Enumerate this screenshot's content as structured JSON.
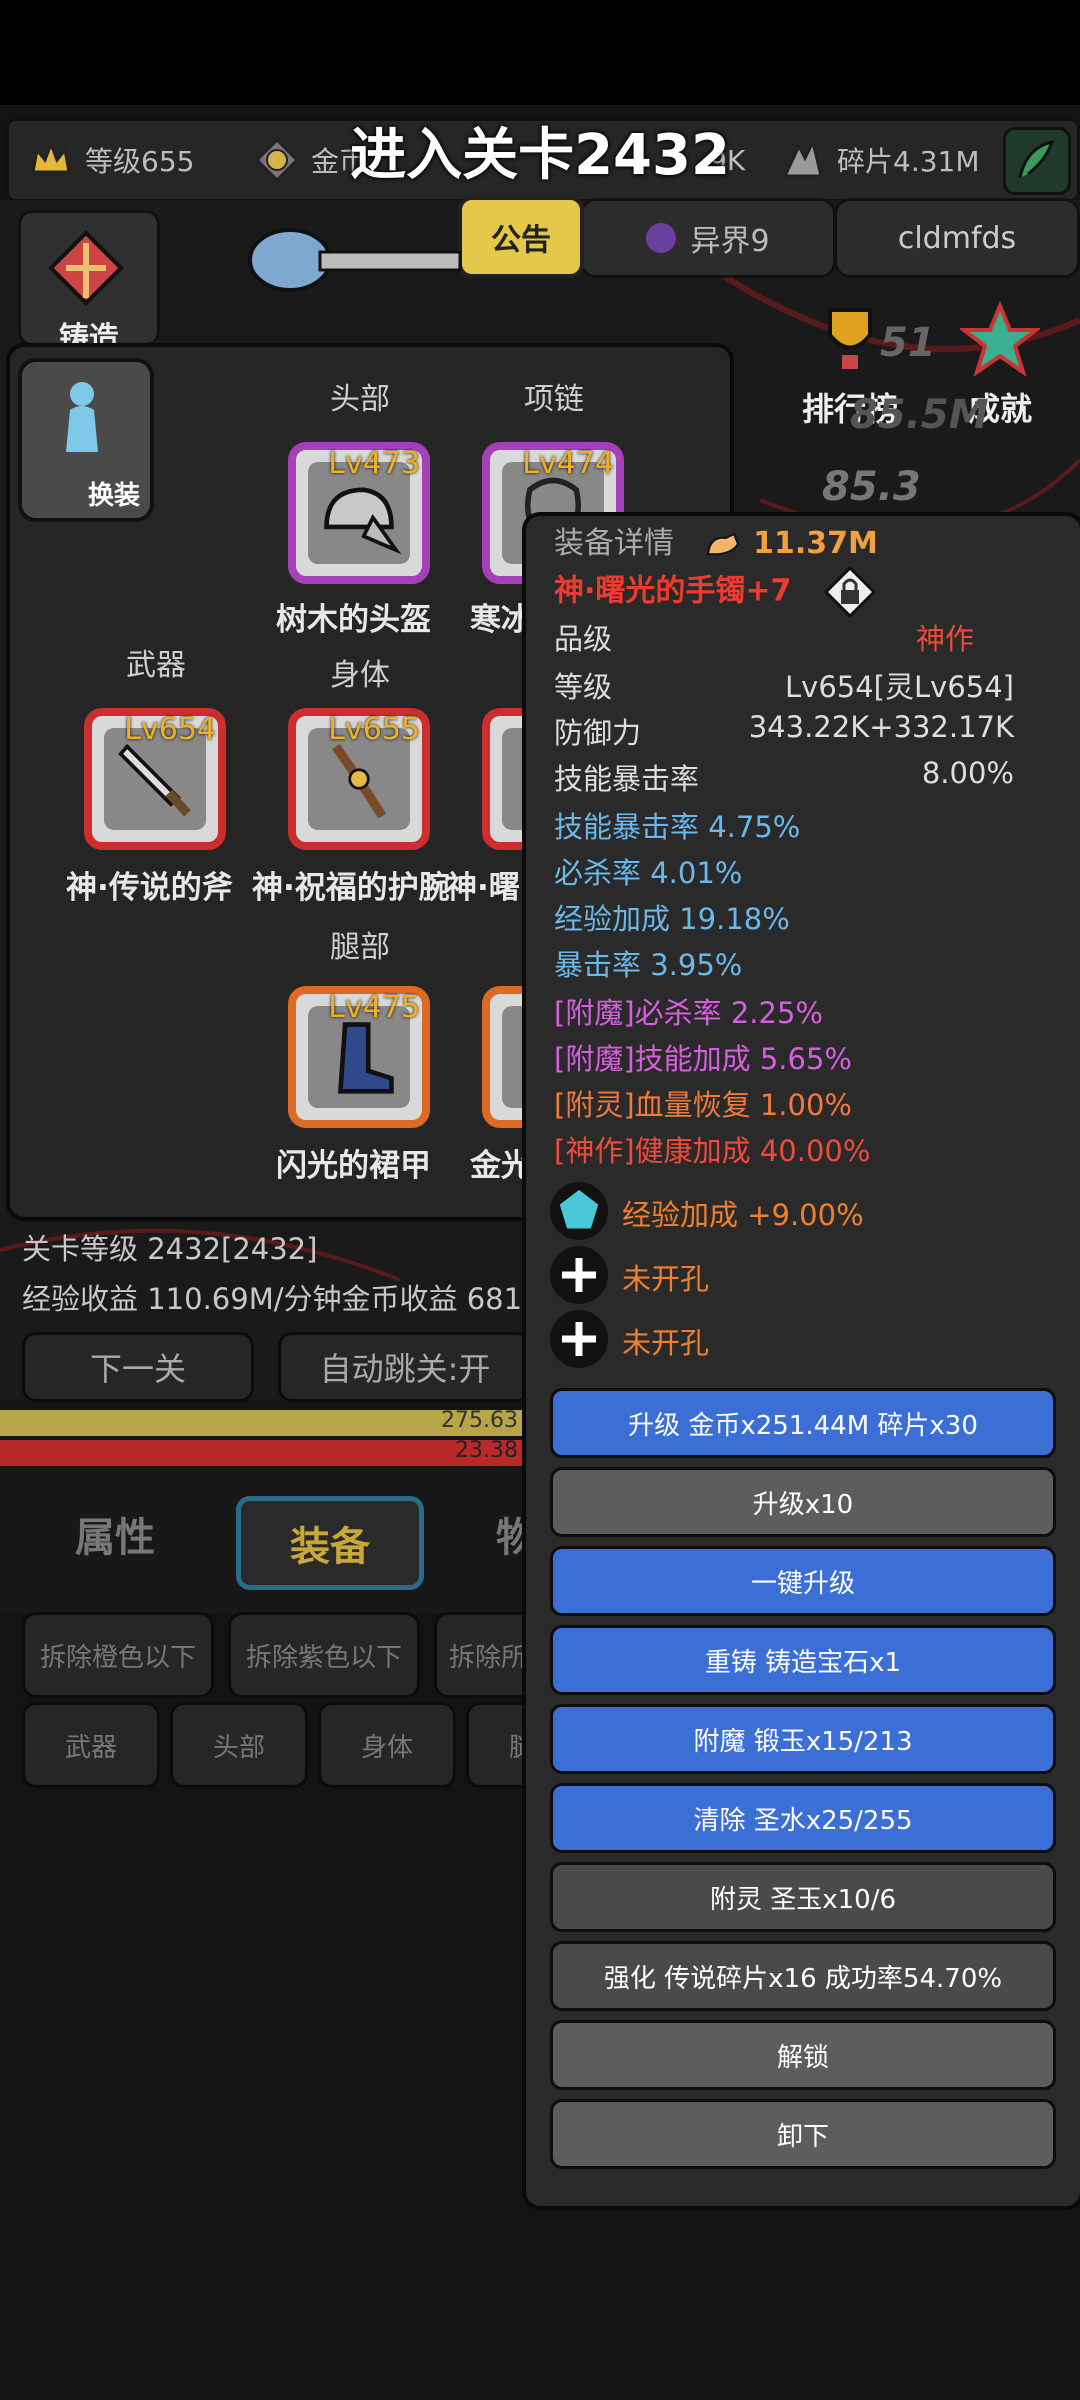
{
  "toast": "进入关卡2432",
  "resources": [
    {
      "icon": "crown-icon",
      "label": "等级655"
    },
    {
      "icon": "gold-coin-icon",
      "label": "金币"
    },
    {
      "icon": "",
      "label": "9K"
    },
    {
      "icon": "shard-icon",
      "label": "碎片4.31M"
    }
  ],
  "top_tabs": {
    "notice": "公告",
    "otherworld": "异界9",
    "username": "cldmfds"
  },
  "side_menu": {
    "cast": "铸造",
    "ranking": "排行榜",
    "achievement": "成就"
  },
  "bg_numbers": [
    "51",
    "85.5M",
    "85.3"
  ],
  "equip_panel": {
    "change_label": "换装",
    "slots": [
      {
        "slot_label": "头部",
        "level": "Lv473",
        "name": "树木的头盔",
        "rarity": "purple"
      },
      {
        "slot_label": "项链",
        "level": "Lv474",
        "name": "寒冰",
        "rarity": "purple"
      },
      {
        "slot_label": "武器",
        "level": "Lv654",
        "name": "神·传说的斧",
        "rarity": "red"
      },
      {
        "slot_label": "身体",
        "level": "Lv655",
        "name": "神·祝福的护腕",
        "rarity": "red"
      },
      {
        "slot_label": "",
        "level": "",
        "name": "神·曙",
        "rarity": "red"
      },
      {
        "slot_label": "腿部",
        "level": "Lv475",
        "name": "闪光的裙甲",
        "rarity": "orange"
      },
      {
        "slot_label": "",
        "level": "",
        "name": "金光",
        "rarity": "orange"
      }
    ]
  },
  "stage_info": {
    "stage_level": "关卡等级 2432[2432]",
    "income": "经验收益 110.69M/分钟金币收益 681."
  },
  "stage_buttons": {
    "next": "下一关",
    "auto": "自动跳关:开"
  },
  "bars": {
    "gold_value": "275.63",
    "red_value": "23.38"
  },
  "bottom_tabs": {
    "attr": "属性",
    "equip": "装备",
    "item": "物"
  },
  "filter_buttons": [
    "拆除橙色以下",
    "拆除紫色以下",
    "拆除所"
  ],
  "category_buttons": [
    "武器",
    "头部",
    "身体",
    "腿"
  ],
  "detail": {
    "header": "装备详情",
    "power": "11.37M",
    "item_name": "神·曙光的手镯+7",
    "rows": [
      {
        "label": "品级",
        "value": "神作"
      },
      {
        "label": "等级",
        "value": "Lv654[灵Lv654]"
      },
      {
        "label": "防御力",
        "value": "343.22K+332.17K"
      },
      {
        "label": "技能暴击率",
        "value": "8.00%"
      }
    ],
    "affixes": [
      {
        "text": "技能暴击率 4.75%",
        "color": "#6ab8ea"
      },
      {
        "text": "必杀率 4.01%",
        "color": "#6ab8ea"
      },
      {
        "text": "经验加成 19.18%",
        "color": "#6ab8ea"
      },
      {
        "text": "暴击率 3.95%",
        "color": "#6ab8ea"
      },
      {
        "text": "[附魔]必杀率 2.25%",
        "color": "#d65fe0"
      },
      {
        "text": "[附魔]技能加成 5.65%",
        "color": "#d65fe0"
      },
      {
        "text": "[附灵]血量恢复 1.00%",
        "color": "#f07a3a"
      },
      {
        "text": "[神作]健康加成 40.00%",
        "color": "#ef4a3a"
      }
    ],
    "sockets": [
      {
        "icon": "gem-icon",
        "text": "经验加成 +9.00%"
      },
      {
        "icon": "plus-icon",
        "text": "未开孔"
      },
      {
        "icon": "plus-icon",
        "text": "未开孔"
      }
    ],
    "buttons": [
      {
        "label": "升级 金币x251.44M 碎片x30",
        "style": "blue"
      },
      {
        "label": "升级x10",
        "style": "gray"
      },
      {
        "label": "一键升级",
        "style": "blue"
      },
      {
        "label": "重铸 铸造宝石x1",
        "style": "blue"
      },
      {
        "label": "附魔 锻玉x15/213",
        "style": "blue"
      },
      {
        "label": "清除 圣水x25/255",
        "style": "blue"
      },
      {
        "label": "附灵 圣玉x10/6",
        "style": "dgray"
      },
      {
        "label": "强化 传说碎片x16 成功率54.70%",
        "style": "dgray"
      },
      {
        "label": "解锁",
        "style": "gray"
      },
      {
        "label": "卸下",
        "style": "gray"
      }
    ]
  },
  "colors": {
    "accent_gold": "#f0b020",
    "detail_name": "#ef3b2f",
    "power": "#f0a040"
  }
}
